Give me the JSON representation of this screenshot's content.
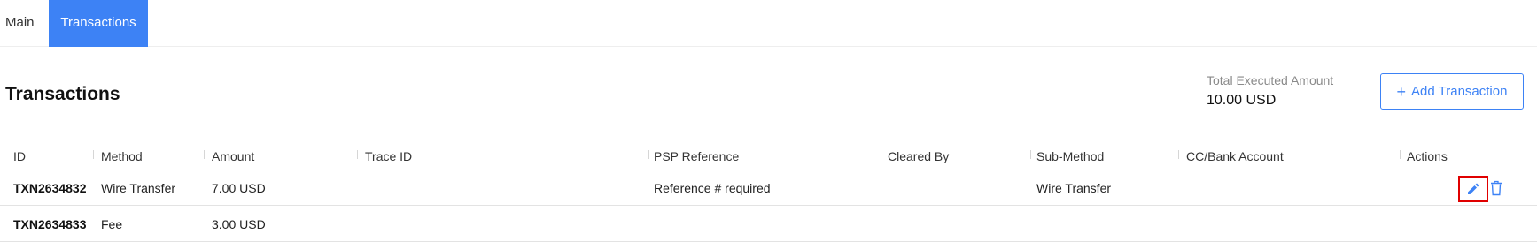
{
  "tabs": [
    {
      "label": "Main",
      "active": false
    },
    {
      "label": "Transactions",
      "active": true
    }
  ],
  "page": {
    "title": "Transactions"
  },
  "summary": {
    "total_label": "Total Executed Amount",
    "total_value": "10.00 USD"
  },
  "actions": {
    "add_transaction_label": "Add Transaction",
    "add_icon": "plus-icon"
  },
  "table": {
    "columns": [
      "ID",
      "Method",
      "Amount",
      "Trace ID",
      "PSP Reference",
      "Cleared By",
      "Sub-Method",
      "CC/Bank Account",
      "Actions"
    ],
    "rows": [
      {
        "id": "TXN2634832",
        "method": "Wire Transfer",
        "amount": "7.00 USD",
        "trace_id": "",
        "psp_reference": "Reference # required",
        "cleared_by": "",
        "sub_method": "Wire Transfer",
        "account": "",
        "actions": [
          "pencil-icon",
          "trash-icon"
        ]
      },
      {
        "id": "TXN2634833",
        "method": "Fee",
        "amount": "3.00 USD",
        "trace_id": "",
        "psp_reference": "",
        "cleared_by": "",
        "sub_method": "",
        "account": "",
        "actions": []
      }
    ]
  },
  "colors": {
    "accent": "#3d82f5",
    "highlight": "#e00000"
  }
}
